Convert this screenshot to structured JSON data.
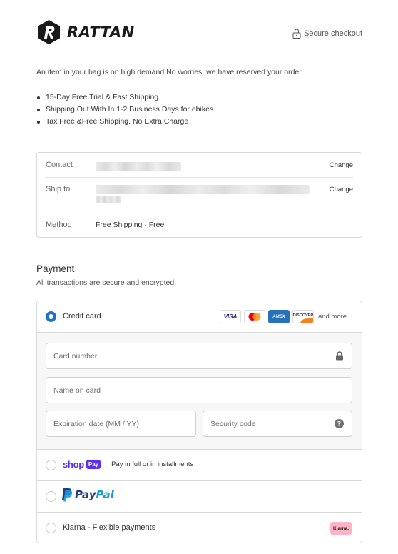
{
  "brand": {
    "name": "RATTAN"
  },
  "header": {
    "secure_label": "Secure checkout"
  },
  "notice": "An item in your bag is on high demand.No worries, we have reserved your order.",
  "bullets": [
    "15-Day Free Trial & Fast Shipping",
    "Shipping Out With In 1-2 Business Days for ebikes",
    "Tax Free &Free Shipping, No Extra Charge"
  ],
  "review": {
    "contact_label": "Contact",
    "shipto_label": "Ship to",
    "method_label": "Method",
    "method_value": "Free Shipping · Free",
    "change_label": "Change"
  },
  "payment": {
    "title": "Payment",
    "subtitle": "All transactions are secure and encrypted.",
    "credit_card_label": "Credit card",
    "card_brands": [
      "VISA",
      "MC",
      "AMEX",
      "DISCOVER"
    ],
    "more_label": "and more...",
    "card_number_placeholder": "Card number",
    "name_placeholder": "Name on card",
    "expiry_placeholder": "Expiration date (MM / YY)",
    "security_placeholder": "Security code",
    "shop_word": "shop",
    "shop_pay_badge": "Pay",
    "shop_pay_desc": "Pay in full or in installments",
    "paypal_a": "Pay",
    "paypal_b": "Pal",
    "klarna_label": "Klarna - Flexible payments",
    "klarna_badge": "Klarna."
  },
  "colors": {
    "accent": "#1a73c7",
    "shop_pay": "#5a31f4",
    "paypal_dark": "#253b80",
    "paypal_light": "#179bd7",
    "klarna": "#ffb3c7"
  }
}
